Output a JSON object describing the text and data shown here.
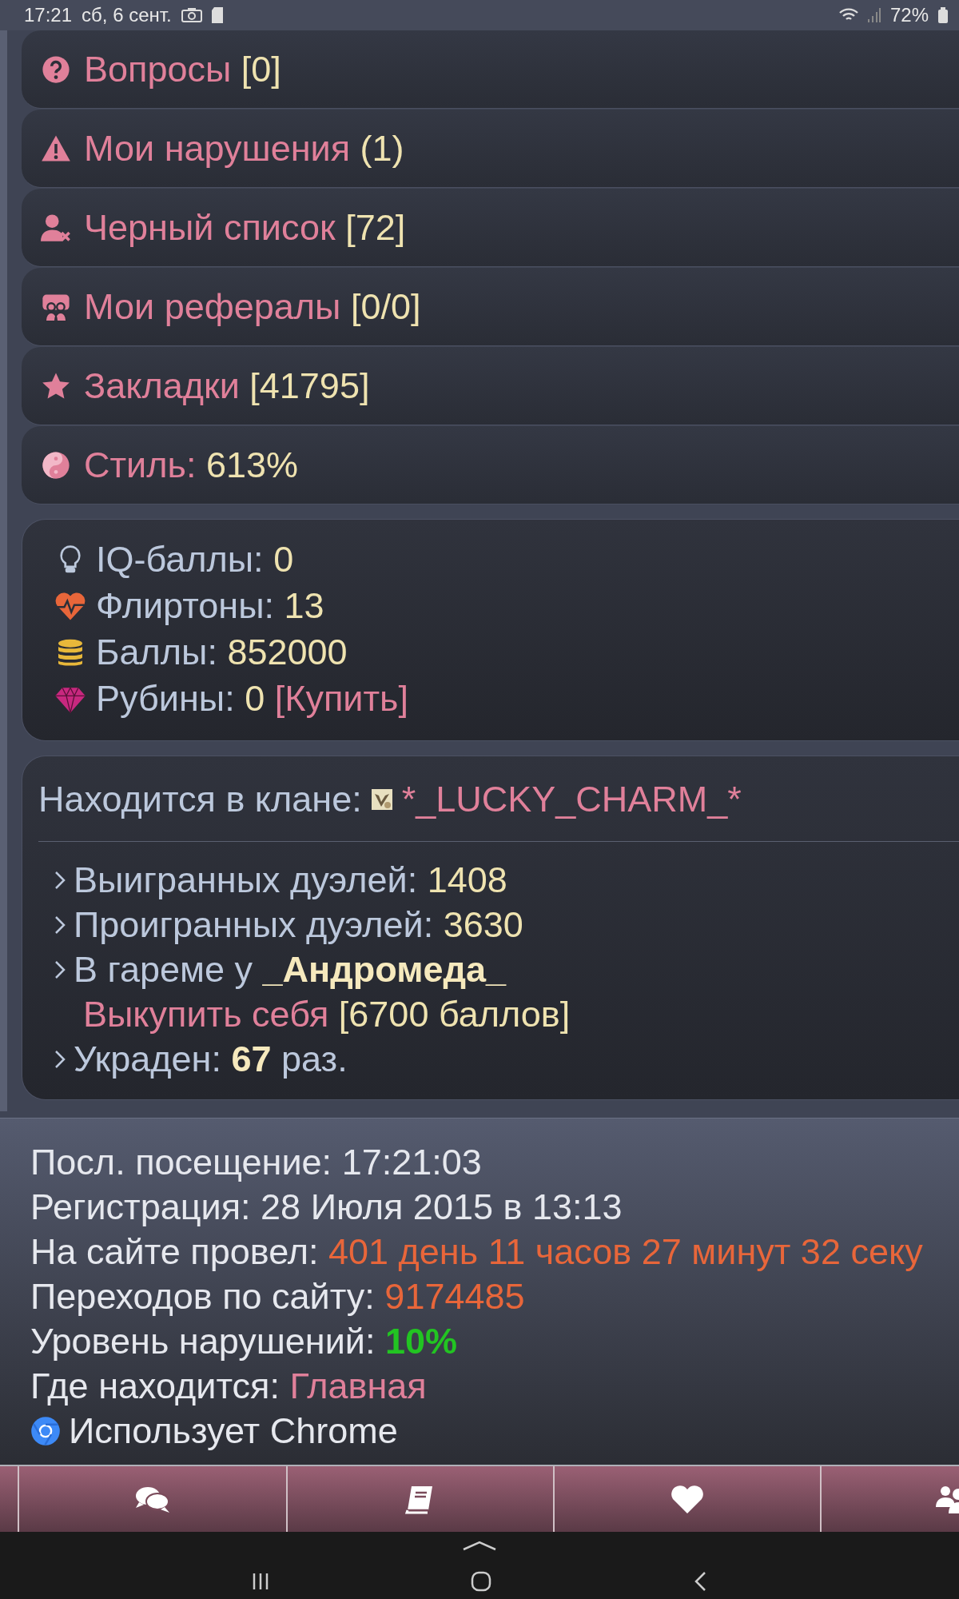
{
  "status_bar": {
    "time": "17:21",
    "date": "сб, 6 сент.",
    "battery": "72%"
  },
  "menu": [
    {
      "kind": "question",
      "label": "Вопросы",
      "count": "[0]"
    },
    {
      "kind": "warning",
      "label": "Мои нарушения",
      "count": "(1)"
    },
    {
      "kind": "blacklist",
      "label": "Черный список",
      "count": "[72]"
    },
    {
      "kind": "referrals",
      "label": "Мои рефералы",
      "count": "[0/0]"
    },
    {
      "kind": "bookmarks",
      "label": "Закладки",
      "count": "[41795]"
    },
    {
      "kind": "style",
      "label": "Стиль:",
      "count": "613%"
    }
  ],
  "stats": [
    {
      "kind": "iq",
      "label": "IQ-баллы:",
      "value": "0"
    },
    {
      "kind": "flirt",
      "label": "Флиртоны:",
      "value": "13"
    },
    {
      "kind": "points",
      "label": "Баллы:",
      "value": "852000"
    },
    {
      "kind": "rubies",
      "label": "Рубины:",
      "value": "0",
      "link": "[Купить]"
    }
  ],
  "clan": {
    "label": "Находится в клане:",
    "name": "*_LUCKY_CHARM_*",
    "items": [
      {
        "kind": "plain",
        "label": "Выигранных дуэлей:",
        "value": "1408"
      },
      {
        "kind": "plain",
        "label": "Проигранных дуэлей:",
        "value": "3630"
      },
      {
        "kind": "harem",
        "label": "В гареме у",
        "owner": "_Андромеда_",
        "link": "Выкупить себя",
        "price": "[6700 баллов]"
      },
      {
        "kind": "stolen",
        "label": "Украден:",
        "value": "67",
        "suffix": "раз."
      }
    ]
  },
  "info": [
    {
      "label": "Посл. посещение:",
      "value": "17:21:03",
      "color": "#e6e8ee"
    },
    {
      "label": "Регистрация:",
      "value": "28 Июля 2015 в 13:13",
      "color": "#e6e8ee"
    },
    {
      "label": "На сайте провел:",
      "value": "401 день 11 часов 27 минут 32 секу",
      "color": "#e8663a"
    },
    {
      "label": "Переходов по сайту:",
      "value": "9174485",
      "color": "#e8663a"
    },
    {
      "label": "Уровень нарушений:",
      "value": "10%",
      "color": "#22c422",
      "bold": true
    },
    {
      "label": "Где находится:",
      "value": "Главная",
      "color": "#e0809a"
    }
  ],
  "browser": {
    "text": "Использует Chrome"
  },
  "nav": [
    {
      "kind": "chat"
    },
    {
      "kind": "diary"
    },
    {
      "kind": "likes"
    },
    {
      "kind": "friends"
    }
  ]
}
